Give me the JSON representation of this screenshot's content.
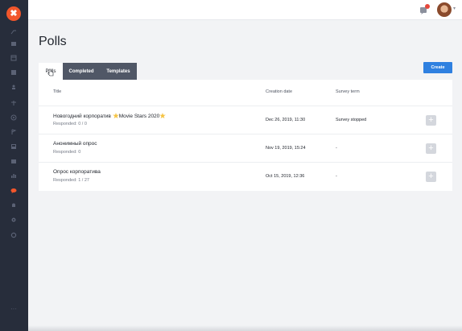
{
  "sidebar": {
    "logo": "✖",
    "icons": [
      "pulse-icon",
      "mail-icon",
      "calendar-icon",
      "contacts-icon",
      "person-icon",
      "target-icon",
      "tree-icon",
      "save-icon",
      "image-icon",
      "chart-icon",
      "message-icon",
      "bell-icon",
      "gear-icon",
      "refresh-icon"
    ],
    "active_color": "#f2562b",
    "more": "···"
  },
  "topbar": {
    "avatar_caret": "▾"
  },
  "page": {
    "title": "Polls"
  },
  "tabs": [
    {
      "label": "Polls",
      "active": true
    },
    {
      "label": "Completed",
      "active": false
    },
    {
      "label": "Templates",
      "active": false
    }
  ],
  "create_button": {
    "label": "Create",
    "color": "#2f80e0"
  },
  "table": {
    "headers": {
      "title": "Title",
      "date": "Creation date",
      "term": "Survey term"
    },
    "rows": [
      {
        "title_a": "Новогодний корпоратив ",
        "title_b": "Movie Stars 2020",
        "sub": "Responded: 0 / 0",
        "date": "Dec 26, 2019, 11:30",
        "term": "Survey stopped",
        "action": "+"
      },
      {
        "title": "Анонимный опрос",
        "sub": "Responded: 0",
        "date": "Nov 19, 2019, 15:24",
        "term": "-",
        "action": "+"
      },
      {
        "title": "Опрос корпоратива",
        "sub": "Responded: 1 / 27",
        "date": "Oct 15, 2019, 12:36",
        "term": "-",
        "action": "+"
      }
    ]
  }
}
